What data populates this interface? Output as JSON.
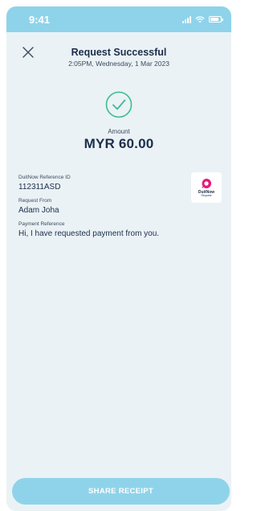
{
  "status_bar": {
    "time": "9:41"
  },
  "header": {
    "title": "Request Successful",
    "subtitle": "2:05PM, Wednesday, 1 Mar 2023"
  },
  "amount": {
    "label": "Amount",
    "value": "MYR 60.00"
  },
  "details": [
    {
      "label": "DuitNow Reference ID",
      "value": "112311ASD"
    },
    {
      "label": "Request From",
      "value": "Adam Joha"
    },
    {
      "label": "Payment Reference",
      "value": "Hi, I have requested payment from you."
    }
  ],
  "logo": {
    "brand": "DuitNow",
    "sub": "Request"
  },
  "actions": {
    "share_label": "SHARE RECEIPT"
  },
  "colors": {
    "accent": "#8fd3ea",
    "success": "#3dbd8a",
    "text_dark": "#1c2e4a",
    "background": "#eaf2f6",
    "logo_pink": "#e6197c"
  }
}
